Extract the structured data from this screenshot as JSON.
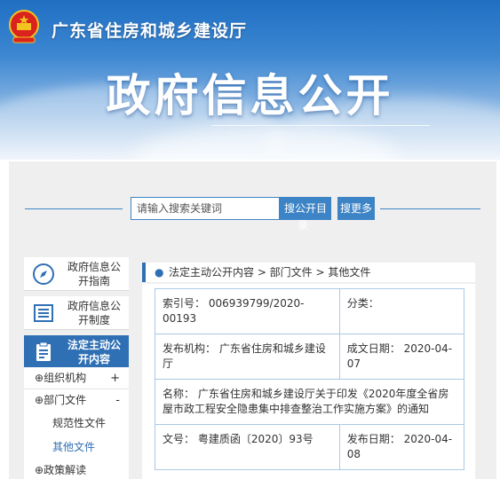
{
  "header": {
    "department": "广东省住房和城乡建设厅",
    "title": "政府信息公开"
  },
  "search": {
    "placeholder": "请输入搜索关键词",
    "btn_open": "搜公开目",
    "btn_open_wrap": "录",
    "btn_more": "搜更多"
  },
  "sidebar": {
    "items": [
      {
        "label": "政府信息公开指南",
        "icon": "compass-icon"
      },
      {
        "label": "政府信息公开制度",
        "icon": "document-list-icon"
      },
      {
        "label": "法定主动公开内容",
        "icon": "clipboard-icon"
      }
    ],
    "tree": {
      "org": "组织机构",
      "org_toggle": "+",
      "dept_files": "部门文件",
      "dept_toggle": "-",
      "sub_normative": "规范性文件",
      "sub_other": "其他文件",
      "policy": "政策解读"
    }
  },
  "breadcrumb": {
    "text": "法定主动公开内容 > 部门文件 > 其他文件"
  },
  "record": {
    "index": "索引号： 006939799/2020-00193",
    "category": "分类：",
    "issuer": "发布机构： 广东省住房和城乡建设厅",
    "created": "成文日期： 2020-04-07",
    "name": "名称： 广东省住房和城乡建设厅关于印发《2020年度全省房屋市政工程安全隐患集中排查整治工作实施方案》的通知",
    "doc_no": "文号： 粤建质函〔2020〕93号",
    "published": "发布日期： 2020-04-08"
  },
  "colors": {
    "accent": "#2f6fb4",
    "border": "#aac9e6"
  }
}
